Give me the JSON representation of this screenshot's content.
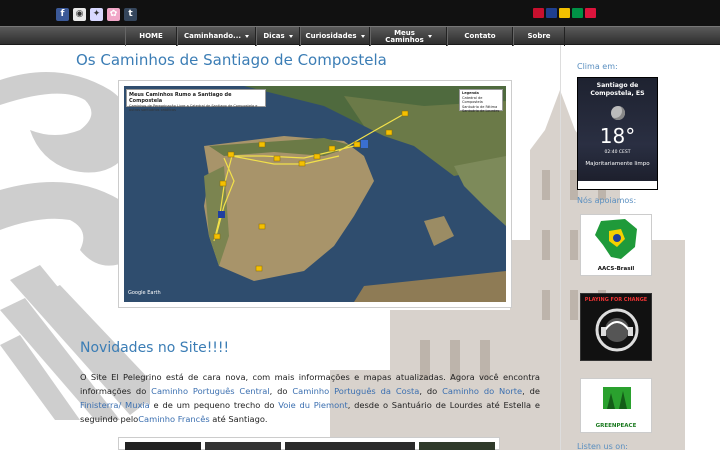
{
  "header": {
    "social_icons": [
      {
        "name": "facebook-icon",
        "glyph": "f",
        "color": "#3b5998"
      },
      {
        "name": "camera-icon",
        "glyph": "◉",
        "color": "#eaeaea"
      },
      {
        "name": "flickr-icon",
        "glyph": "✦",
        "color": "#d8d8ff"
      },
      {
        "name": "picasa-icon",
        "glyph": "✿",
        "color": "#f1a7c8"
      },
      {
        "name": "tumblr-icon",
        "glyph": "t",
        "color": "#35465c"
      }
    ],
    "flags": [
      {
        "name": "portugal-flag-icon",
        "color": "#c8102e"
      },
      {
        "name": "uk-flag-icon",
        "color": "#1f3f8f"
      },
      {
        "name": "spain-flag-icon",
        "color": "#f1bf00"
      },
      {
        "name": "italy-flag-icon",
        "color": "#009246"
      },
      {
        "name": "poland-flag-icon",
        "color": "#dc143c"
      }
    ]
  },
  "nav": {
    "items": [
      {
        "label": "HOME",
        "caret": false
      },
      {
        "label": "Caminhando...",
        "caret": true
      },
      {
        "label": "Dicas",
        "caret": true
      },
      {
        "label": "Curiosidades",
        "caret": true
      },
      {
        "label": "Meus\nCaminhos",
        "caret": true
      },
      {
        "label": "Contato",
        "caret": false
      },
      {
        "label": "Sobre",
        "caret": false
      }
    ]
  },
  "main": {
    "title": "Os Caminhos de Santiago de Compostela",
    "map": {
      "title": "Meus Caminhos Rumo a Santiago de Compostela",
      "subtitle": "Caminhos de Peregrinação Livre a Catedral de Santiago de Compostela e outros santuários católicos",
      "legend_title": "Legenda",
      "legend_items": [
        "Catedral de Compostela",
        "Santuário de Fátima",
        "Santuário de Lourdes"
      ],
      "credit": "Google Earth"
    },
    "news_title": "Novidades no Site!!!!",
    "paragraph": {
      "t1": "O Site El Pelegrino está de cara nova, com mais informações e mapas atualizadas. Agora você encontra informações do ",
      "l1": "Caminho Português Central",
      "t2": ", do ",
      "l2": "Caminho Português da Costa",
      "t3": ", do ",
      "l3": "Caminho do Norte",
      "t4": ", de ",
      "l4": "Finisterra/ Muxia",
      "t5": " e de um pequeno trecho do ",
      "l5": "Voie du Piemont",
      "t6": ", desde o Santuário de Lourdes até Estella e seguindo pelo",
      "l6": "Caminho Francês",
      "t7": " até Santiago."
    }
  },
  "sidebar": {
    "weather_heading": "Clima em:",
    "weather": {
      "city": "Santiago de Compostela, ES",
      "temp": "18°",
      "time": "02:40 CEST",
      "condition": "Majoritariamente limpo"
    },
    "sponsors_heading": "Nós apoiamos:",
    "sponsors": [
      {
        "label": "AACS-Brasil"
      },
      {
        "label": "PLAYING FOR CHANGE"
      },
      {
        "label": "GREENPEACE"
      }
    ],
    "listen_heading": "Listen us on:"
  }
}
